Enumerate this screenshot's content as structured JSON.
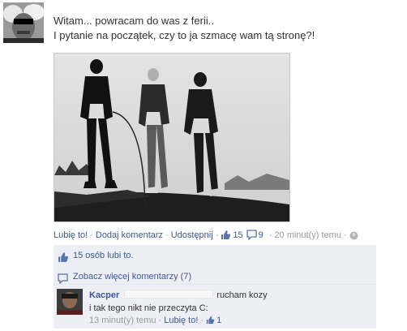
{
  "post": {
    "message_lines": [
      "Witam... powracam do was z ferii..",
      "I pytanie na początek, czy to ja szmacę wam tą stronę?!"
    ],
    "actions": {
      "like": "Lubię to!",
      "comment": "Dodaj komentarz",
      "share": "Udostępnij",
      "like_count": "15",
      "comment_count": "9",
      "time": "20 minut(y) temu"
    }
  },
  "feedback": {
    "likes_text": "15 osób lubi to.",
    "more_comments": "Zobacz więcej komentarzy (7)"
  },
  "comment": {
    "author": "Kacper",
    "text_line1": "rucham kozy",
    "text_line2": "i tak tego nikt nie przeczyta C:",
    "time": "13 minut(y) temu",
    "like": "Lubię to!",
    "like_count": "1"
  },
  "colors": {
    "link": "#3b5998",
    "meta_gray": "#999999",
    "ufi_background": "#edeff4"
  },
  "icons": {
    "thumbs_up": "thumbs-up-icon",
    "comment_bubble": "comment-bubble-icon",
    "globe": "globe-icon"
  }
}
